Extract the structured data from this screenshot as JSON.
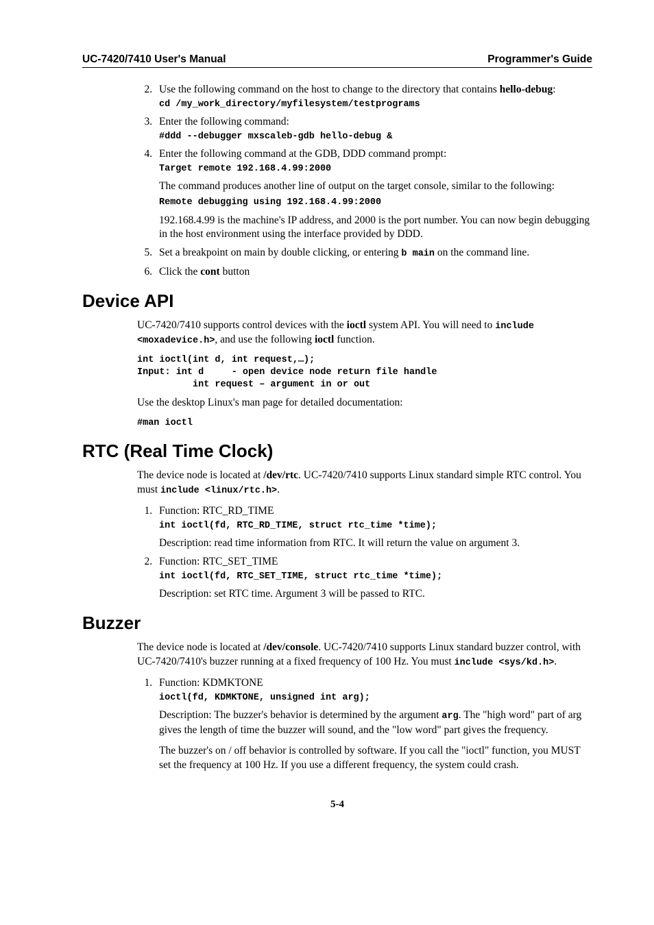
{
  "header": {
    "left": "UC-7420/7410 User's Manual",
    "right": "Programmer's Guide"
  },
  "top_list": {
    "start": 2,
    "items": [
      {
        "text_pre": "Use the following command on the host to change to the directory that contains ",
        "bold1": "hello-debug",
        "tail": ":",
        "code": "cd /my_work_directory/myfilesystem/testprograms"
      },
      {
        "text_pre": "Enter the following command:",
        "code": "#ddd --debugger mxscaleb-gdb hello-debug &"
      },
      {
        "text_pre": "Enter the following command at the GDB, DDD command prompt:",
        "code1": "Target remote 192.168.4.99:2000",
        "para1": "The command produces another line of output on the target console, similar to the following:",
        "code2": "Remote debugging using 192.168.4.99:2000",
        "para2": "192.168.4.99 is the machine's IP address, and 2000 is the port number. You can now begin debugging in the host environment using the interface provided by DDD."
      },
      {
        "text_pre": "Set a breakpoint on main by double clicking, or entering ",
        "code_inline": "b main",
        "text_post": " on the command line."
      },
      {
        "text_pre": "Click the ",
        "bold1": "cont",
        "tail": " button"
      }
    ]
  },
  "device_api": {
    "title": "Device API",
    "p1a": "UC-7420/7410 supports control devices with the ",
    "p1b": "ioctl",
    "p1c": " system API. You will need to  ",
    "p1code1": "include <moxadevice.h>",
    "p1d": ", and use the following ",
    "p1e": "ioctl",
    "p1f": " function.",
    "code": "int ioctl(int d, int request,…);\nInput: int d     - open device node return file handle\n          int request – argument in or out",
    "p2": "Use the desktop Linux's man page for detailed documentation:",
    "code2": "#man ioctl"
  },
  "rtc": {
    "title": "RTC (Real Time Clock)",
    "p1a": "The device node is located at ",
    "p1b": "/dev/rtc",
    "p1c": ". UC-7420/7410 supports Linux standard simple RTC control. You must ",
    "p1code": "include <linux/rtc.h>",
    "p1d": ".",
    "items": [
      {
        "head": "Function: RTC_RD_TIME",
        "code": "int ioctl(fd, RTC_RD_TIME, struct rtc_time *time);",
        "desc": "Description: read time information from RTC. It will return the value on argument 3."
      },
      {
        "head": "Function: RTC_SET_TIME",
        "code": "int ioctl(fd, RTC_SET_TIME, struct rtc_time *time);",
        "desc": "Description: set RTC time. Argument 3 will be passed to RTC."
      }
    ]
  },
  "buzzer": {
    "title": "Buzzer",
    "p1a": "The device node is located at ",
    "p1b": "/dev/console",
    "p1c": ". UC-7420/7410 supports Linux standard buzzer control, with UC-7420/7410's buzzer running at a fixed frequency of 100 Hz. You must ",
    "p1code": "include <sys/kd.h>",
    "p1d": ".",
    "item": {
      "head": "Function: KDMKTONE",
      "code": "ioctl(fd, KDMKTONE, unsigned int arg);",
      "d1a": "Description: The buzzer's behavior is determined by the argument ",
      "d1code": "arg",
      "d1b": ". The \"high word\" part of arg gives the length of time the buzzer will sound, and the \"low word\" part gives the frequency.",
      "d2": "The buzzer's on / off behavior is controlled by software. If you call the \"ioctl\" function, you MUST set the frequency at 100 Hz. If you use a different frequency, the system could crash."
    }
  },
  "page_number": "5-4"
}
